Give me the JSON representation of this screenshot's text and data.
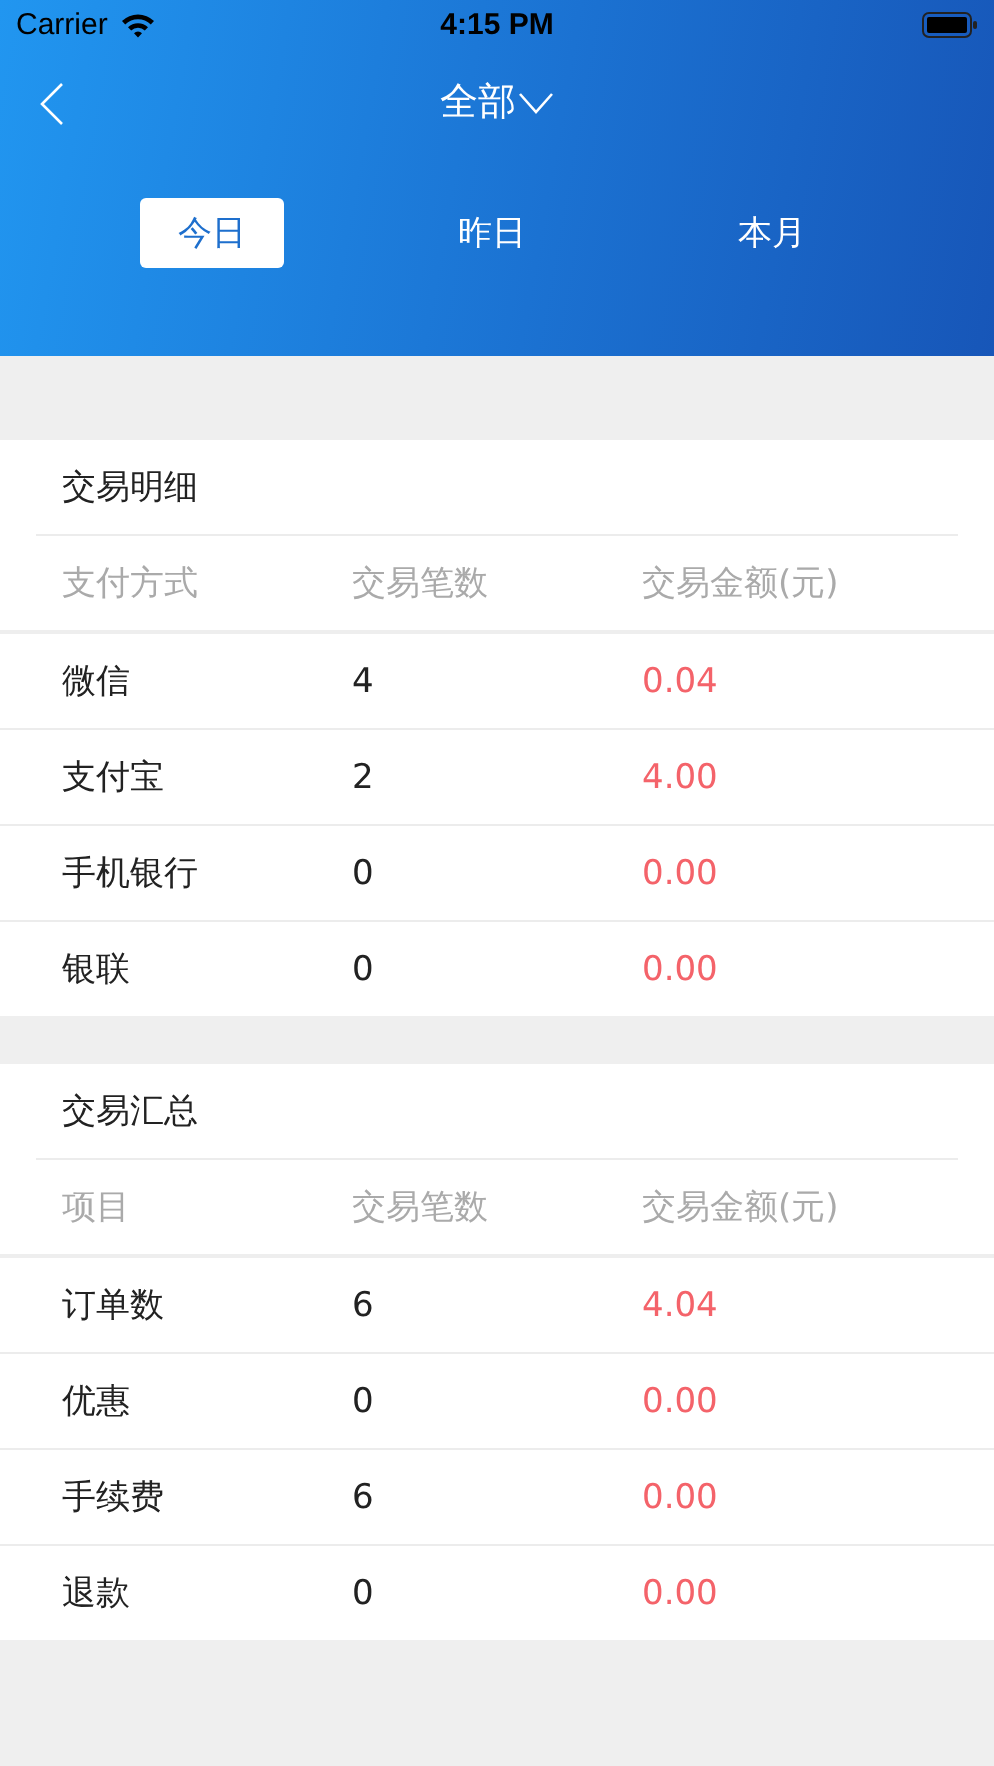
{
  "status_bar": {
    "carrier": "Carrier",
    "time": "4:15 PM"
  },
  "nav": {
    "title": "全部"
  },
  "tabs": [
    {
      "label": "今日",
      "selected": true
    },
    {
      "label": "昨日",
      "selected": false
    },
    {
      "label": "本月",
      "selected": false
    }
  ],
  "sections": [
    {
      "title": "交易明细",
      "columns": [
        "支付方式",
        "交易笔数",
        "交易金额(元)"
      ],
      "rows": [
        {
          "name": "微信",
          "count": "4",
          "amount": "0.04"
        },
        {
          "name": "支付宝",
          "count": "2",
          "amount": "4.00"
        },
        {
          "name": "手机银行",
          "count": "0",
          "amount": "0.00"
        },
        {
          "name": "银联",
          "count": "0",
          "amount": "0.00"
        }
      ]
    },
    {
      "title": "交易汇总",
      "columns": [
        "项目",
        "交易笔数",
        "交易金额(元)"
      ],
      "rows": [
        {
          "name": "订单数",
          "count": "6",
          "amount": "4.04"
        },
        {
          "name": "优惠",
          "count": "0",
          "amount": "0.00"
        },
        {
          "name": "手续费",
          "count": "6",
          "amount": "0.00"
        },
        {
          "name": "退款",
          "count": "0",
          "amount": "0.00"
        }
      ]
    }
  ]
}
